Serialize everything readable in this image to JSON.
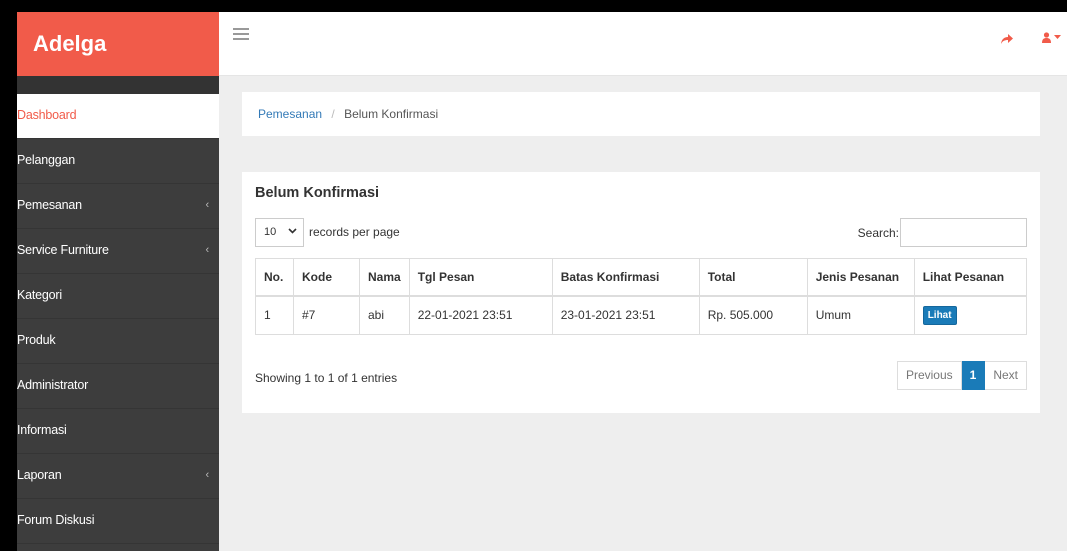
{
  "brand": {
    "title": "Adelga"
  },
  "topbar": {
    "menu_icon": "hamburger-icon",
    "share_icon": "share-icon",
    "user_icon": "user-icon"
  },
  "sidebar": {
    "items": [
      {
        "label": "Dashboard",
        "active": true,
        "has_submenu": false
      },
      {
        "label": "Pelanggan",
        "active": false,
        "has_submenu": false
      },
      {
        "label": "Pemesanan",
        "active": false,
        "has_submenu": true
      },
      {
        "label": "Service Furniture",
        "active": false,
        "has_submenu": true
      },
      {
        "label": "Kategori",
        "active": false,
        "has_submenu": false
      },
      {
        "label": "Produk",
        "active": false,
        "has_submenu": false
      },
      {
        "label": "Administrator",
        "active": false,
        "has_submenu": false
      },
      {
        "label": "Informasi",
        "active": false,
        "has_submenu": false
      },
      {
        "label": "Laporan",
        "active": false,
        "has_submenu": true
      },
      {
        "label": "Forum Diskusi",
        "active": false,
        "has_submenu": false
      }
    ],
    "submenu_chevron": "‹"
  },
  "breadcrumb": {
    "parent": "Pemesanan",
    "separator": "/",
    "current": "Belum Konfirmasi"
  },
  "card": {
    "title": "Belum Konfirmasi",
    "length_value": "10",
    "length_label": "records per page",
    "search_label": "Search:",
    "search_value": "",
    "table": {
      "headers": [
        "No.",
        "Kode",
        "Nama",
        "Tgl Pesan",
        "Batas Konfirmasi",
        "Total",
        "Jenis Pesanan",
        "Lihat Pesanan"
      ],
      "rows": [
        {
          "no": "1",
          "kode": "#7",
          "nama": "abi",
          "tgl_pesan": "22-01-2021 23:51",
          "batas": "23-01-2021 23:51",
          "total": "Rp. 505.000",
          "jenis": "Umum",
          "action": "Lihat"
        }
      ]
    },
    "info": "Showing 1 to 1 of 1 entries",
    "pager": {
      "previous": "Previous",
      "current": "1",
      "next": "Next"
    }
  },
  "colors": {
    "brand": "#f15b4a",
    "sidebar": "#3d3d3d",
    "accent": "#1a7bb8"
  }
}
